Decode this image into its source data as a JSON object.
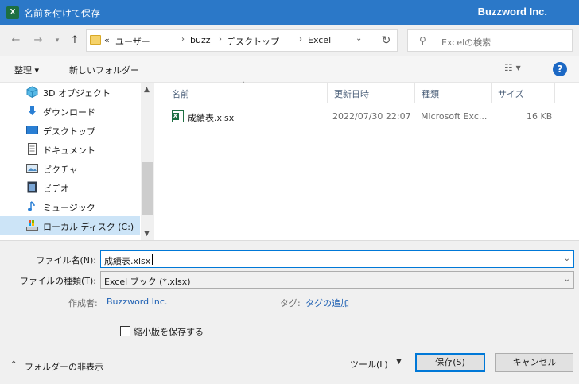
{
  "window": {
    "title": "名前を付けて保存",
    "brand": "Buzzword Inc.",
    "app_icon_letter": "X"
  },
  "address": {
    "prefix": "«",
    "crumbs": [
      "ユーザー",
      "buzz",
      "デスクトップ",
      "Excel"
    ]
  },
  "search": {
    "placeholder": "Excelの検索"
  },
  "toolbar": {
    "organize": "整理 ▾",
    "new_folder": "新しいフォルダー"
  },
  "nav_items": [
    {
      "label": "3D オブジェクト",
      "icon": "cube-icon"
    },
    {
      "label": "ダウンロード",
      "icon": "download-icon"
    },
    {
      "label": "デスクトップ",
      "icon": "desktop-icon"
    },
    {
      "label": "ドキュメント",
      "icon": "document-icon"
    },
    {
      "label": "ピクチャ",
      "icon": "picture-icon"
    },
    {
      "label": "ビデオ",
      "icon": "video-icon"
    },
    {
      "label": "ミュージック",
      "icon": "music-icon"
    },
    {
      "label": "ローカル ディスク (C:)",
      "icon": "drive-icon",
      "selected": true
    }
  ],
  "columns": [
    "名前",
    "更新日時",
    "種類",
    "サイズ"
  ],
  "files": [
    {
      "name": "成績表.xlsx",
      "modified": "2022/07/30 22:07",
      "type": "Microsoft Exc...",
      "size": "16 KB"
    }
  ],
  "form": {
    "filename_label": "ファイル名(N):",
    "filename_value": "成績表.xlsx",
    "filetype_label": "ファイルの種類(T):",
    "filetype_value": "Excel ブック (*.xlsx)",
    "author_label": "作成者:",
    "author_value": "Buzzword Inc.",
    "tags_label": "タグ:",
    "tags_value": "タグの追加",
    "thumbnail_label": "縮小版を保存する"
  },
  "footer": {
    "hide_folders": "フォルダーの非表示",
    "tools": "ツール(L)",
    "save": "保存(S)",
    "cancel": "キャンセル"
  },
  "colors": {
    "titlebar": "#2b78c8",
    "accent": "#0078d7",
    "link": "#1c5fb3",
    "selection": "#cce4f7"
  }
}
